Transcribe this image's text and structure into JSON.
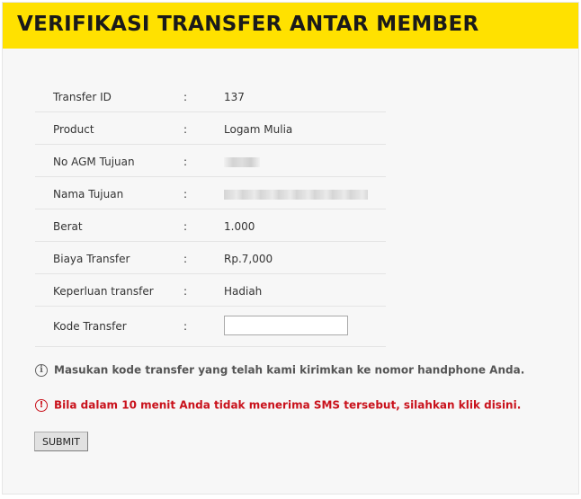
{
  "header": {
    "title": "VERIFIKASI TRANSFER ANTAR MEMBER",
    "background": "#ffe100"
  },
  "form": {
    "separator": ":",
    "rows": [
      {
        "label": "Transfer ID",
        "value": "137"
      },
      {
        "label": "Product",
        "value": "Logam Mulia"
      },
      {
        "label": "No AGM Tujuan",
        "value": ""
      },
      {
        "label": "Nama Tujuan",
        "value": ""
      },
      {
        "label": "Berat",
        "value": "1.000"
      },
      {
        "label": "Biaya Transfer",
        "value": "Rp.7,000"
      },
      {
        "label": "Keperluan transfer",
        "value": "Hadiah"
      },
      {
        "label": "Kode Transfer",
        "value": ""
      }
    ],
    "kode_transfer_input": {
      "value": "",
      "placeholder": ""
    }
  },
  "notices": {
    "info_icon": "info-circle-icon",
    "info_text": "Masukan kode transfer yang telah kami kirimkan ke nomor handphone Anda.",
    "warning_icon": "exclamation-circle-icon",
    "warning_text": "Bila dalam 10 menit Anda tidak menerima SMS tersebut, silahkan klik disini.",
    "warning_color": "#c9111b"
  },
  "submit": {
    "label": "SUBMIT"
  }
}
